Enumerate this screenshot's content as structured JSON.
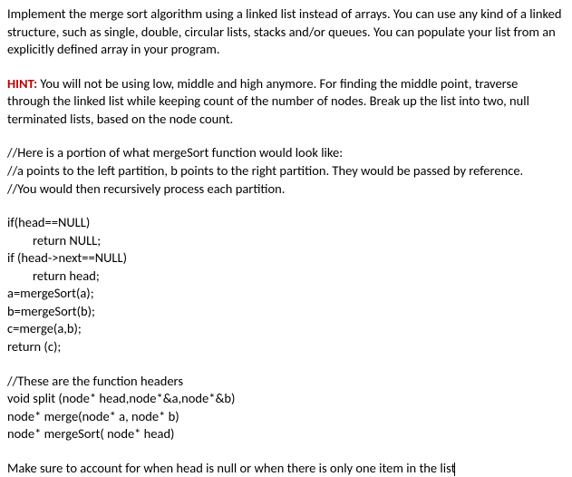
{
  "intro": "Implement the merge sort algorithm using a linked list instead of arrays. You can use any kind of a linked structure, such as single, double, circular lists, stacks and/or queues. You can populate your list from an explicitly defined array in your program.",
  "hint_label": "HINT:",
  "hint_text": " You will not be using low, middle and high anymore. For finding the middle point, traverse through the linked list while keeping count of the number of nodes. Break up the list into two, null terminated lists, based on the node count.",
  "comment1_lines": [
    "//Here is a portion of what mergeSort function would look like:",
    "//a points to the left partition, b points to the right partition. They would be passed by reference.",
    "//You would then recursively process each partition."
  ],
  "code_lines": [
    {
      "text": "if(head==NULL)",
      "indent": false
    },
    {
      "text": "return NULL;",
      "indent": true
    },
    {
      "text": "if (head->next==NULL)",
      "indent": false
    },
    {
      "text": "return head;",
      "indent": true
    },
    {
      "text": "a=mergeSort(a);",
      "indent": false
    },
    {
      "text": "b=mergeSort(b);",
      "indent": false
    },
    {
      "text": "c=merge(a,b);",
      "indent": false
    },
    {
      "text": "return (c);",
      "indent": false
    }
  ],
  "header_lines": [
    "//These are the function headers",
    "void split (node* head,node*&a,node*&b)",
    "node* merge(node* a, node* b)",
    "node* mergeSort( node* head)"
  ],
  "final_note": "Make sure to account for when head is null or when there is only one item in the list"
}
